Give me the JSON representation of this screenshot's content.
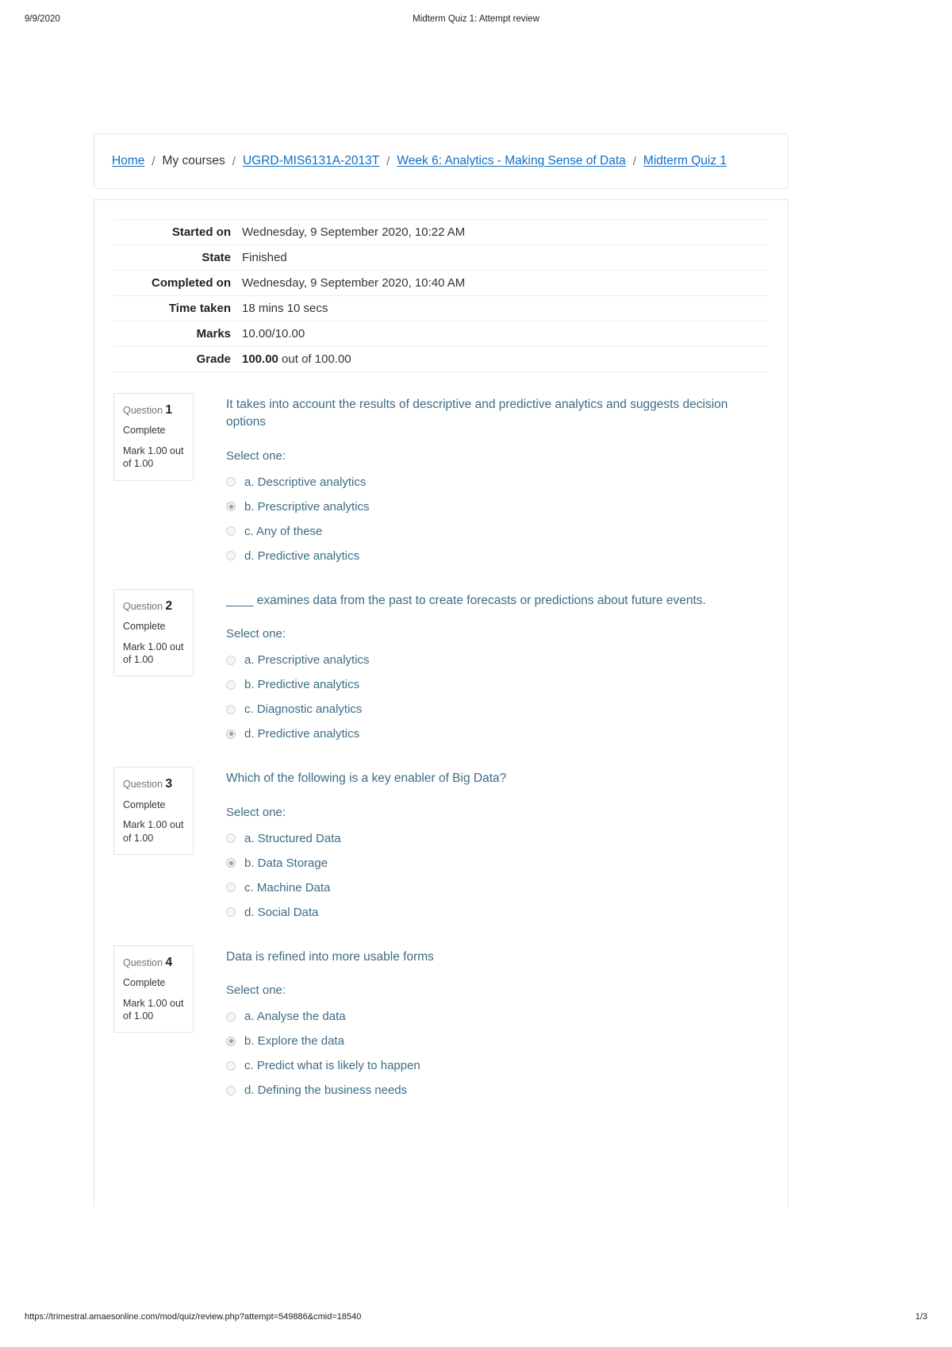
{
  "print_header": {
    "date": "9/9/2020",
    "title": "Midterm Quiz 1: Attempt review"
  },
  "print_footer": {
    "url": "https://trimestral.amaesonline.com/mod/quiz/review.php?attempt=549886&cmid=18540",
    "page": "1/3"
  },
  "breadcrumb": {
    "items": [
      {
        "label": "Home",
        "link": true
      },
      {
        "label": "My courses",
        "link": false
      },
      {
        "label": "UGRD-MIS6131A-2013T",
        "link": true
      },
      {
        "label": "Week 6: Analytics - Making Sense of Data",
        "link": true
      },
      {
        "label": "Midterm Quiz 1",
        "link": true
      }
    ],
    "separator": "/"
  },
  "summary": {
    "rows": [
      {
        "label": "Started on",
        "value": "Wednesday, 9 September 2020, 10:22 AM",
        "bold_prefix": ""
      },
      {
        "label": "State",
        "value": "Finished",
        "bold_prefix": ""
      },
      {
        "label": "Completed on",
        "value": "Wednesday, 9 September 2020, 10:40 AM",
        "bold_prefix": ""
      },
      {
        "label": "Time taken",
        "value": "18 mins 10 secs",
        "bold_prefix": ""
      },
      {
        "label": "Marks",
        "value": "10.00/10.00",
        "bold_prefix": ""
      },
      {
        "label": "Grade",
        "value": " out of 100.00",
        "bold_prefix": "100.00"
      }
    ]
  },
  "labels": {
    "question_word": "Question",
    "select_one": "Select one:"
  },
  "questions": [
    {
      "number": "1",
      "state": "Complete",
      "mark": "Mark 1.00 out of 1.00",
      "text": "It takes into account the results of descriptive and predictive analytics and suggests decision options",
      "select_one": "Select one:",
      "options": [
        {
          "label": "a. Descriptive analytics",
          "selected": false
        },
        {
          "label": "b. Prescriptive analytics",
          "selected": true
        },
        {
          "label": "c. Any of these",
          "selected": false
        },
        {
          "label": "d. Predictive analytics",
          "selected": false
        }
      ]
    },
    {
      "number": "2",
      "state": "Complete",
      "mark": "Mark 1.00 out of 1.00",
      "text": "____ examines data from the past to create forecasts or predictions about future events.",
      "select_one": "Select one:",
      "options": [
        {
          "label": "a. Prescriptive analytics",
          "selected": false
        },
        {
          "label": "b. Predictive analytics",
          "selected": false
        },
        {
          "label": "c. Diagnostic analytics",
          "selected": false
        },
        {
          "label": "d. Predictive analytics",
          "selected": true
        }
      ]
    },
    {
      "number": "3",
      "state": "Complete",
      "mark": "Mark 1.00 out of 1.00",
      "text": "Which of the following is a key enabler of Big Data?",
      "select_one": "Select one:",
      "options": [
        {
          "label": "a. Structured Data",
          "selected": false
        },
        {
          "label": "b. Data Storage",
          "selected": true
        },
        {
          "label": "c. Machine Data",
          "selected": false
        },
        {
          "label": "d. Social Data",
          "selected": false
        }
      ]
    },
    {
      "number": "4",
      "state": "Complete",
      "mark": "Mark 1.00 out of 1.00",
      "text": "Data is refined into more usable forms",
      "select_one": "Select one:",
      "options": [
        {
          "label": "a. Analyse the data",
          "selected": false
        },
        {
          "label": "b. Explore the data",
          "selected": true
        },
        {
          "label": "c. Predict what is likely to happen",
          "selected": false
        },
        {
          "label": "d. Defining the business needs",
          "selected": false
        }
      ]
    }
  ],
  "colors": {
    "link": "#0f6fc5",
    "question_text": "#3d6c87",
    "border": "#e3e6e8"
  }
}
